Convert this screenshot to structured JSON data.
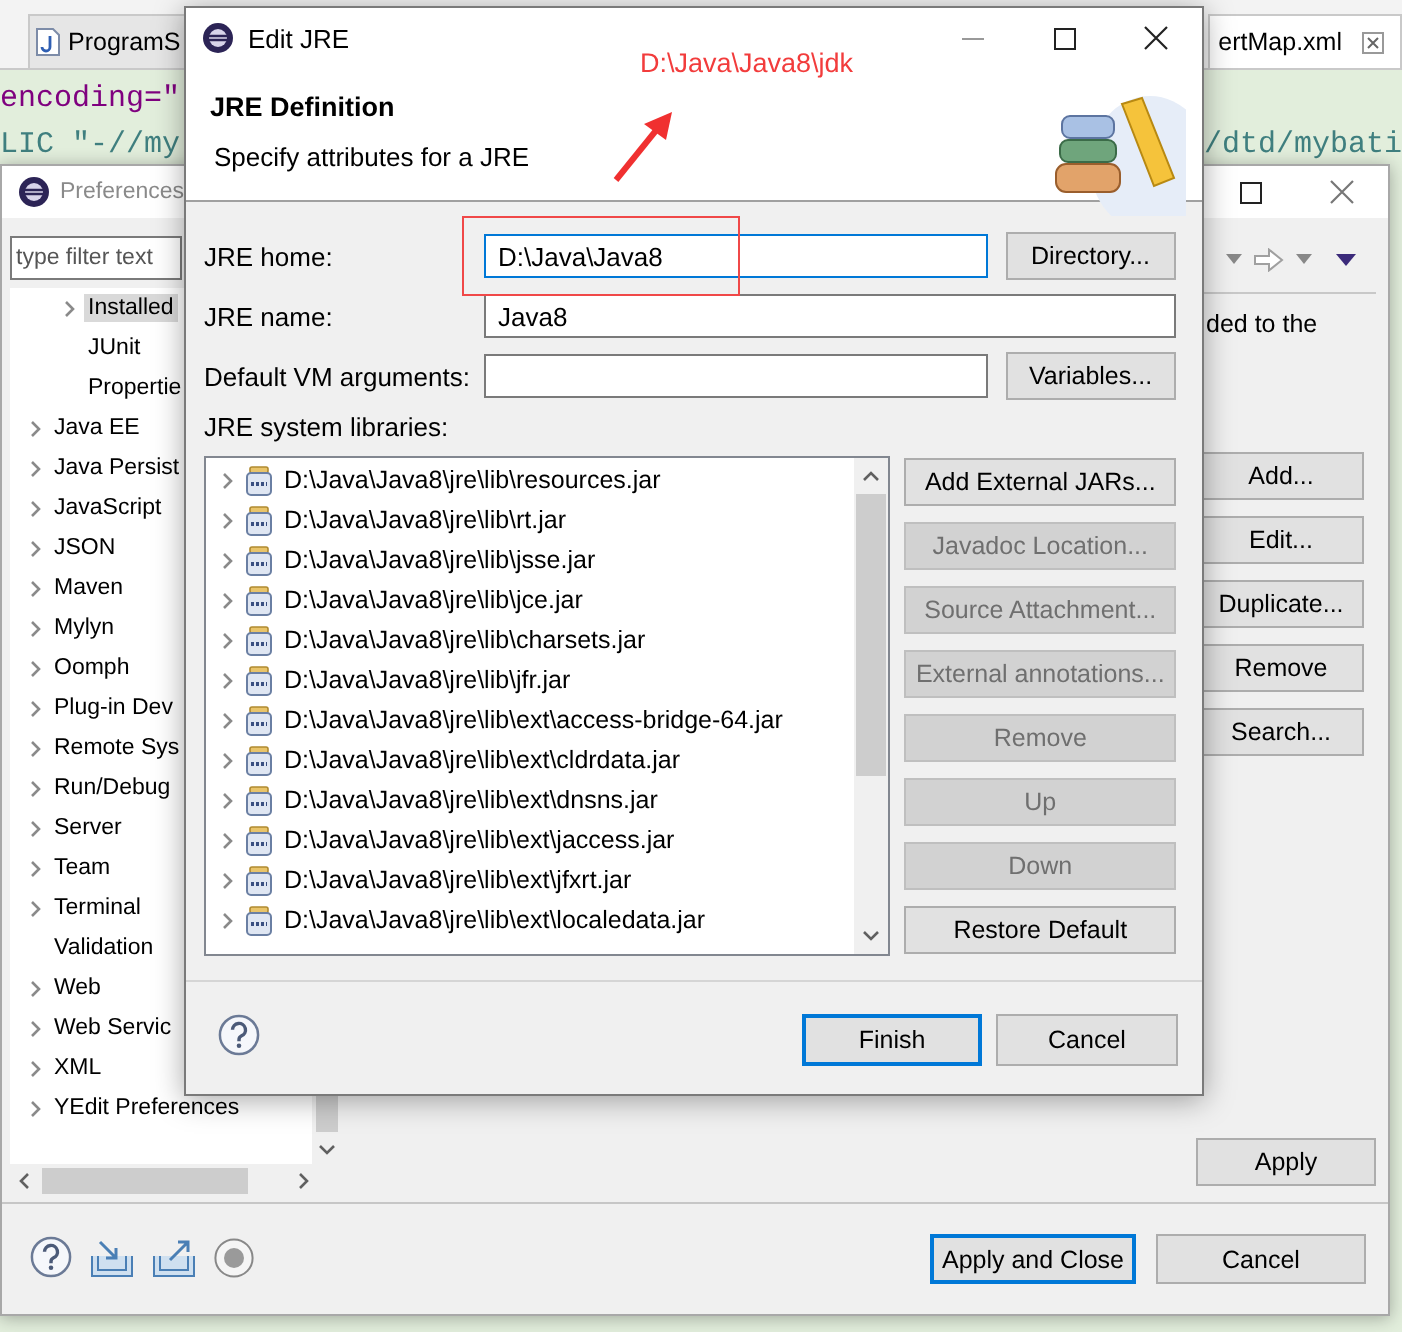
{
  "editor": {
    "tabs": [
      {
        "label": "ProgramS",
        "selected": false
      },
      {
        "label": "ertMap.xml",
        "selected": true
      }
    ],
    "code_lines": [
      {
        "fragments": [
          {
            "text": "encoding=\"",
            "kind": "attribute"
          }
        ]
      },
      {
        "fragments": [
          {
            "text": "LIC \"-//my",
            "kind": "doctype"
          },
          {
            "text": "/dtd/mybati",
            "kind": "doctype"
          }
        ]
      }
    ]
  },
  "preferences": {
    "title": "Preferences",
    "filter": {
      "placeholder": "type filter text"
    },
    "tree": {
      "open_branch_children": [
        {
          "label": "Installed",
          "expandable": true,
          "selected": true
        },
        {
          "label": "JUnit",
          "expandable": false,
          "selected": false
        },
        {
          "label": "Propertie",
          "expandable": false,
          "selected": false
        }
      ],
      "items": [
        {
          "label": "Java EE",
          "expandable": true,
          "selected": false
        },
        {
          "label": "Java Persist",
          "expandable": true,
          "selected": false
        },
        {
          "label": "JavaScript",
          "expandable": true,
          "selected": false
        },
        {
          "label": "JSON",
          "expandable": true,
          "selected": false
        },
        {
          "label": "Maven",
          "expandable": true,
          "selected": false
        },
        {
          "label": "Mylyn",
          "expandable": true,
          "selected": false
        },
        {
          "label": "Oomph",
          "expandable": true,
          "selected": false
        },
        {
          "label": "Plug-in Dev",
          "expandable": true,
          "selected": false
        },
        {
          "label": "Remote Sys",
          "expandable": true,
          "selected": false
        },
        {
          "label": "Run/Debug",
          "expandable": true,
          "selected": false
        },
        {
          "label": "Server",
          "expandable": true,
          "selected": false
        },
        {
          "label": "Team",
          "expandable": true,
          "selected": false
        },
        {
          "label": "Terminal",
          "expandable": true,
          "selected": false
        },
        {
          "label": "Validation",
          "expandable": false,
          "selected": false
        },
        {
          "label": "Web",
          "expandable": true,
          "selected": false
        },
        {
          "label": "Web Servic",
          "expandable": true,
          "selected": false
        },
        {
          "label": "XML",
          "expandable": true,
          "selected": false
        },
        {
          "label": "YEdit Preferences",
          "expandable": true,
          "selected": false
        }
      ]
    },
    "page_text": "ded to the",
    "side_buttons": [
      "Add...",
      "Edit...",
      "Duplicate...",
      "Remove",
      "Search..."
    ],
    "apply_button": "Apply",
    "footer_buttons": [
      {
        "label": "Apply and Close",
        "default": true
      },
      {
        "label": "Cancel",
        "default": false
      }
    ]
  },
  "dialog": {
    "title": "Edit JRE",
    "heading": "JRE Definition",
    "description": "Specify attributes for a JRE",
    "fields": [
      {
        "label": "JRE home:",
        "value": "D:\\Java\\Java8",
        "focused": true,
        "button": "Directory..."
      },
      {
        "label": "JRE name:",
        "value": "Java8",
        "focused": false
      },
      {
        "label": "Default VM arguments:",
        "focused": false,
        "button": "Variables..."
      }
    ],
    "libraries_label": "JRE system libraries:",
    "libraries": [
      "D:\\Java\\Java8\\jre\\lib\\resources.jar",
      "D:\\Java\\Java8\\jre\\lib\\rt.jar",
      "D:\\Java\\Java8\\jre\\lib\\jsse.jar",
      "D:\\Java\\Java8\\jre\\lib\\jce.jar",
      "D:\\Java\\Java8\\jre\\lib\\charsets.jar",
      "D:\\Java\\Java8\\jre\\lib\\jfr.jar",
      "D:\\Java\\Java8\\jre\\lib\\ext\\access-bridge-64.jar",
      "D:\\Java\\Java8\\jre\\lib\\ext\\cldrdata.jar",
      "D:\\Java\\Java8\\jre\\lib\\ext\\dnsns.jar",
      "D:\\Java\\Java8\\jre\\lib\\ext\\jaccess.jar",
      "D:\\Java\\Java8\\jre\\lib\\ext\\jfxrt.jar",
      "D:\\Java\\Java8\\jre\\lib\\ext\\localedata.jar"
    ],
    "library_buttons": [
      {
        "label": "Add External JARs...",
        "disabled": false
      },
      {
        "label": "Javadoc Location...",
        "disabled": true
      },
      {
        "label": "Source Attachment...",
        "disabled": true
      },
      {
        "label": "External annotations...",
        "disabled": true
      },
      {
        "label": "Remove",
        "disabled": true
      },
      {
        "label": "Up",
        "disabled": true
      },
      {
        "label": "Down",
        "disabled": true
      },
      {
        "label": "Restore Default",
        "disabled": false
      }
    ],
    "footer_buttons": [
      {
        "label": "Finish",
        "default": true
      },
      {
        "label": "Cancel",
        "default": false
      }
    ]
  },
  "annotation": {
    "text": "D:\\Java\\Java8\\jdk"
  }
}
